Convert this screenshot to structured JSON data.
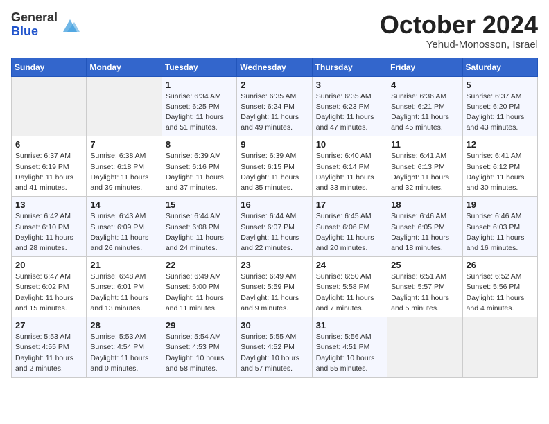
{
  "header": {
    "logo_line1": "General",
    "logo_line2": "Blue",
    "month": "October 2024",
    "location": "Yehud-Monosson, Israel"
  },
  "days_of_week": [
    "Sunday",
    "Monday",
    "Tuesday",
    "Wednesday",
    "Thursday",
    "Friday",
    "Saturday"
  ],
  "weeks": [
    [
      {
        "day": "",
        "detail": ""
      },
      {
        "day": "",
        "detail": ""
      },
      {
        "day": "1",
        "detail": "Sunrise: 6:34 AM\nSunset: 6:25 PM\nDaylight: 11 hours and 51 minutes."
      },
      {
        "day": "2",
        "detail": "Sunrise: 6:35 AM\nSunset: 6:24 PM\nDaylight: 11 hours and 49 minutes."
      },
      {
        "day": "3",
        "detail": "Sunrise: 6:35 AM\nSunset: 6:23 PM\nDaylight: 11 hours and 47 minutes."
      },
      {
        "day": "4",
        "detail": "Sunrise: 6:36 AM\nSunset: 6:21 PM\nDaylight: 11 hours and 45 minutes."
      },
      {
        "day": "5",
        "detail": "Sunrise: 6:37 AM\nSunset: 6:20 PM\nDaylight: 11 hours and 43 minutes."
      }
    ],
    [
      {
        "day": "6",
        "detail": "Sunrise: 6:37 AM\nSunset: 6:19 PM\nDaylight: 11 hours and 41 minutes."
      },
      {
        "day": "7",
        "detail": "Sunrise: 6:38 AM\nSunset: 6:18 PM\nDaylight: 11 hours and 39 minutes."
      },
      {
        "day": "8",
        "detail": "Sunrise: 6:39 AM\nSunset: 6:16 PM\nDaylight: 11 hours and 37 minutes."
      },
      {
        "day": "9",
        "detail": "Sunrise: 6:39 AM\nSunset: 6:15 PM\nDaylight: 11 hours and 35 minutes."
      },
      {
        "day": "10",
        "detail": "Sunrise: 6:40 AM\nSunset: 6:14 PM\nDaylight: 11 hours and 33 minutes."
      },
      {
        "day": "11",
        "detail": "Sunrise: 6:41 AM\nSunset: 6:13 PM\nDaylight: 11 hours and 32 minutes."
      },
      {
        "day": "12",
        "detail": "Sunrise: 6:41 AM\nSunset: 6:12 PM\nDaylight: 11 hours and 30 minutes."
      }
    ],
    [
      {
        "day": "13",
        "detail": "Sunrise: 6:42 AM\nSunset: 6:10 PM\nDaylight: 11 hours and 28 minutes."
      },
      {
        "day": "14",
        "detail": "Sunrise: 6:43 AM\nSunset: 6:09 PM\nDaylight: 11 hours and 26 minutes."
      },
      {
        "day": "15",
        "detail": "Sunrise: 6:44 AM\nSunset: 6:08 PM\nDaylight: 11 hours and 24 minutes."
      },
      {
        "day": "16",
        "detail": "Sunrise: 6:44 AM\nSunset: 6:07 PM\nDaylight: 11 hours and 22 minutes."
      },
      {
        "day": "17",
        "detail": "Sunrise: 6:45 AM\nSunset: 6:06 PM\nDaylight: 11 hours and 20 minutes."
      },
      {
        "day": "18",
        "detail": "Sunrise: 6:46 AM\nSunset: 6:05 PM\nDaylight: 11 hours and 18 minutes."
      },
      {
        "day": "19",
        "detail": "Sunrise: 6:46 AM\nSunset: 6:03 PM\nDaylight: 11 hours and 16 minutes."
      }
    ],
    [
      {
        "day": "20",
        "detail": "Sunrise: 6:47 AM\nSunset: 6:02 PM\nDaylight: 11 hours and 15 minutes."
      },
      {
        "day": "21",
        "detail": "Sunrise: 6:48 AM\nSunset: 6:01 PM\nDaylight: 11 hours and 13 minutes."
      },
      {
        "day": "22",
        "detail": "Sunrise: 6:49 AM\nSunset: 6:00 PM\nDaylight: 11 hours and 11 minutes."
      },
      {
        "day": "23",
        "detail": "Sunrise: 6:49 AM\nSunset: 5:59 PM\nDaylight: 11 hours and 9 minutes."
      },
      {
        "day": "24",
        "detail": "Sunrise: 6:50 AM\nSunset: 5:58 PM\nDaylight: 11 hours and 7 minutes."
      },
      {
        "day": "25",
        "detail": "Sunrise: 6:51 AM\nSunset: 5:57 PM\nDaylight: 11 hours and 5 minutes."
      },
      {
        "day": "26",
        "detail": "Sunrise: 6:52 AM\nSunset: 5:56 PM\nDaylight: 11 hours and 4 minutes."
      }
    ],
    [
      {
        "day": "27",
        "detail": "Sunrise: 5:53 AM\nSunset: 4:55 PM\nDaylight: 11 hours and 2 minutes."
      },
      {
        "day": "28",
        "detail": "Sunrise: 5:53 AM\nSunset: 4:54 PM\nDaylight: 11 hours and 0 minutes."
      },
      {
        "day": "29",
        "detail": "Sunrise: 5:54 AM\nSunset: 4:53 PM\nDaylight: 10 hours and 58 minutes."
      },
      {
        "day": "30",
        "detail": "Sunrise: 5:55 AM\nSunset: 4:52 PM\nDaylight: 10 hours and 57 minutes."
      },
      {
        "day": "31",
        "detail": "Sunrise: 5:56 AM\nSunset: 4:51 PM\nDaylight: 10 hours and 55 minutes."
      },
      {
        "day": "",
        "detail": ""
      },
      {
        "day": "",
        "detail": ""
      }
    ]
  ]
}
